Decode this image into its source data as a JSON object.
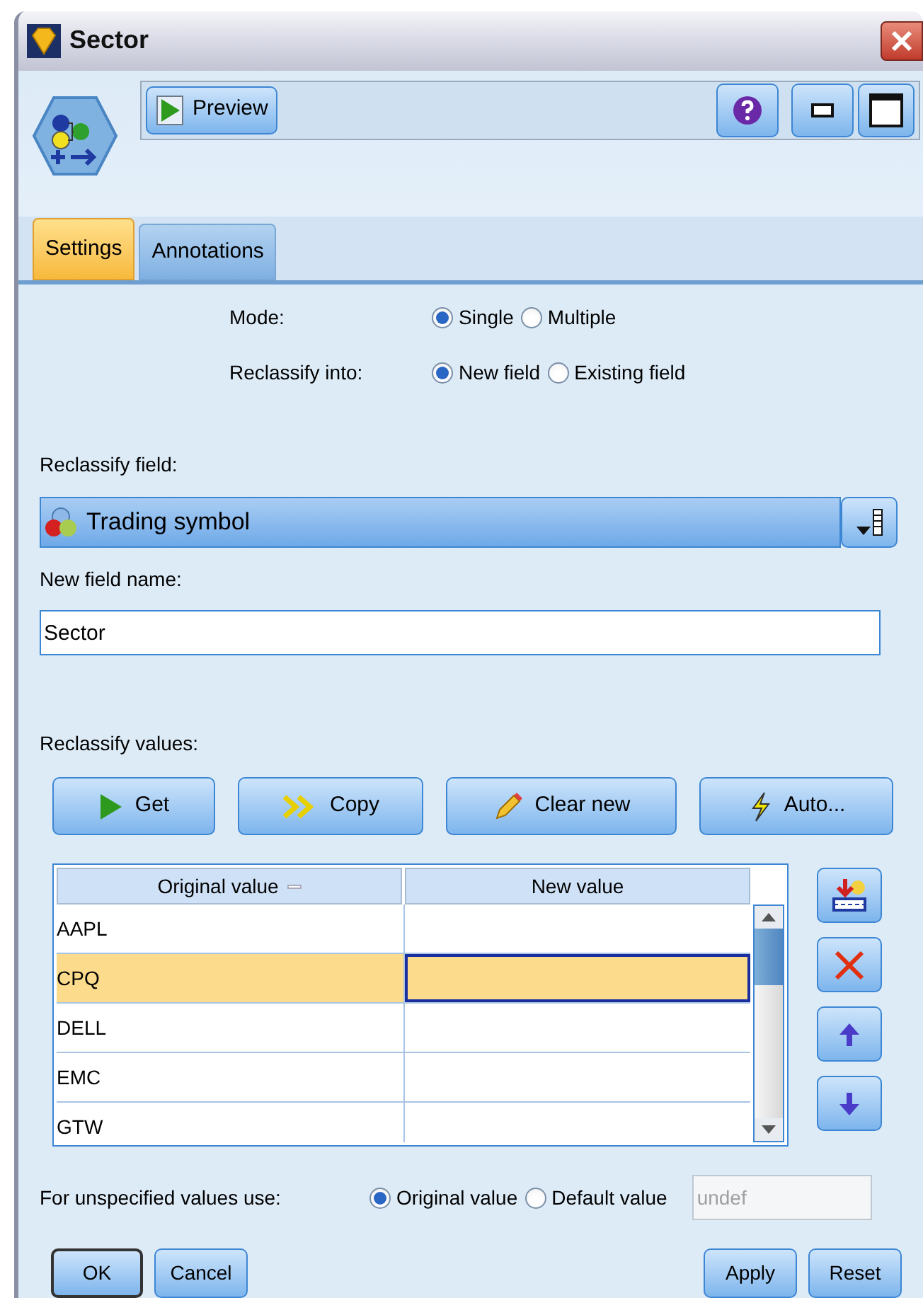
{
  "window": {
    "title": "Sector"
  },
  "toolbar": {
    "preview_button": "Preview"
  },
  "tabs": [
    {
      "label": "Settings",
      "selected": true
    },
    {
      "label": "Annotations",
      "selected": false
    }
  ],
  "mode": {
    "label": "Mode:",
    "options": [
      {
        "label": "Single",
        "selected": true
      },
      {
        "label": "Multiple",
        "selected": false
      }
    ]
  },
  "reclassify_into": {
    "label": "Reclassify into:",
    "options": [
      {
        "label": "New field",
        "selected": true
      },
      {
        "label": "Existing field",
        "selected": false
      }
    ]
  },
  "reclassify_field": {
    "label": "Reclassify field:",
    "value": "Trading symbol"
  },
  "new_field_name": {
    "label": "New field name:",
    "value": "Sector"
  },
  "reclassify_values": {
    "label": "Reclassify values:",
    "buttons": [
      {
        "kind": "get",
        "label": "Get"
      },
      {
        "kind": "copy",
        "label": "Copy"
      },
      {
        "kind": "clear",
        "label": "Clear new"
      },
      {
        "kind": "auto",
        "label": "Auto..."
      }
    ]
  },
  "table": {
    "columns": [
      "Original value",
      "New value"
    ],
    "rows": [
      {
        "original": "AAPL",
        "selected": false
      },
      {
        "original": "CPQ",
        "selected": true
      },
      {
        "original": "DELL",
        "selected": false
      },
      {
        "original": "EMC",
        "selected": false
      },
      {
        "original": "GTW",
        "selected": false
      }
    ]
  },
  "unspecified": {
    "label": "For unspecified values use:",
    "options": [
      {
        "label": "Original value",
        "selected": true
      },
      {
        "label": "Default value",
        "selected": false
      }
    ],
    "default_field": {
      "value": "undef",
      "disabled": true
    }
  },
  "footer": {
    "left": [
      "OK",
      "Cancel"
    ],
    "right": [
      "Apply",
      "Reset"
    ]
  }
}
